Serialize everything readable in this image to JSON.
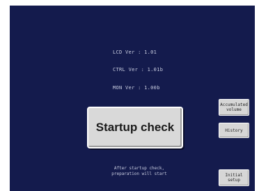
{
  "versions": {
    "lcd": "LCD Ver : 1.01",
    "ctrl": "CTRL Ver : 1.01b",
    "mon": "MON Ver : 1.00b"
  },
  "startup_check_label": "Startup check",
  "side_buttons": {
    "accumulated_volume": "Accumulated\nvolume",
    "history": "History",
    "initial_setup": "Initial\nsetup"
  },
  "hint_text": "After startup check,\npreparation will start",
  "colors": {
    "screen_background": "#141b4d",
    "button_face": "#d9d9d9",
    "text_light": "#c9cde0"
  }
}
